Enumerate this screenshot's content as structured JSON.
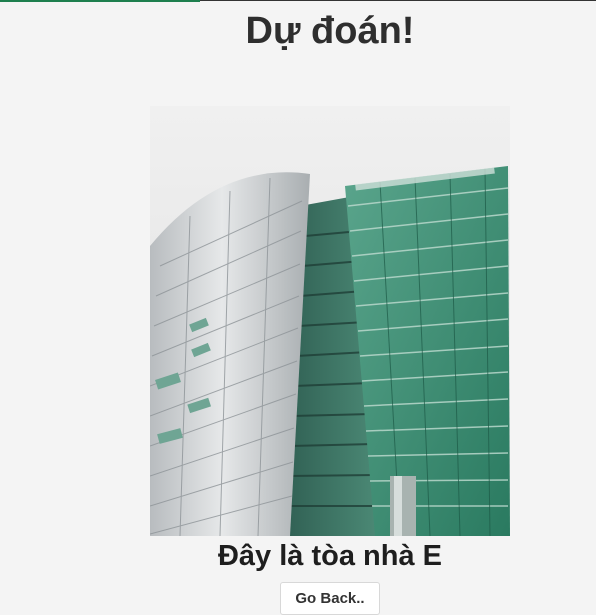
{
  "page": {
    "title": "Dự đoán!",
    "result_text": "Đây là tòa nhà E",
    "back_button_label": "Go Back.."
  },
  "photo": {
    "subject": "building-photo",
    "colors": {
      "sky": "#e6e6e6",
      "glass_facade": "#3f8f77",
      "silver_tower": "#c4c7c9"
    }
  }
}
